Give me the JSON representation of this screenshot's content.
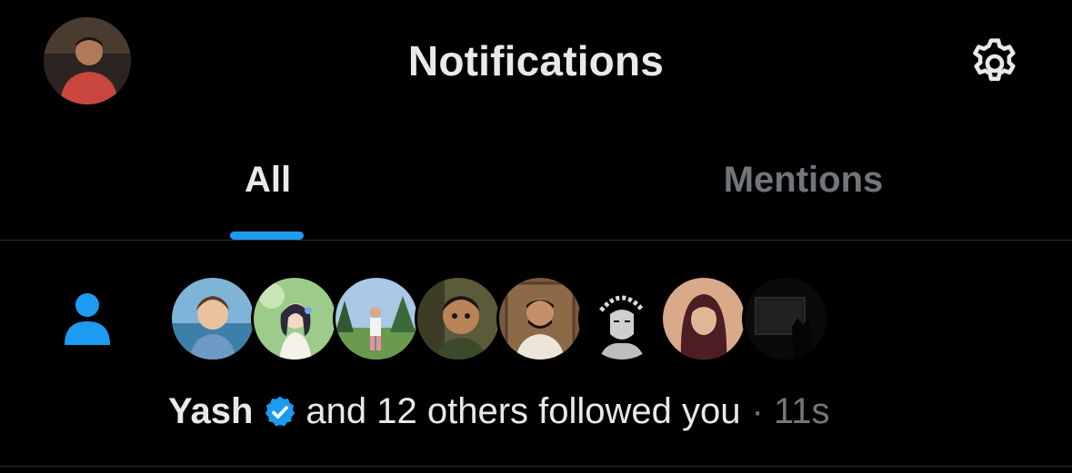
{
  "header": {
    "title": "Notifications",
    "profile_avatar_icon": "user-avatar",
    "settings_icon": "gear-icon"
  },
  "tabs": [
    {
      "label": "All",
      "active": true
    },
    {
      "label": "Mentions",
      "active": false
    }
  ],
  "notification": {
    "type_icon": "person-follow-icon",
    "name": "Yash",
    "verified": true,
    "text": "and 12 others followed you",
    "separator": "·",
    "time": "11s",
    "follower_avatars": [
      "avatar-1",
      "avatar-2",
      "avatar-3",
      "avatar-4",
      "avatar-5",
      "avatar-6",
      "avatar-7",
      "avatar-8"
    ]
  },
  "colors": {
    "background": "#000000",
    "text_primary": "#e7e9ea",
    "text_secondary": "#71767b",
    "accent": "#1d9bf0",
    "divider": "#2f3336"
  }
}
